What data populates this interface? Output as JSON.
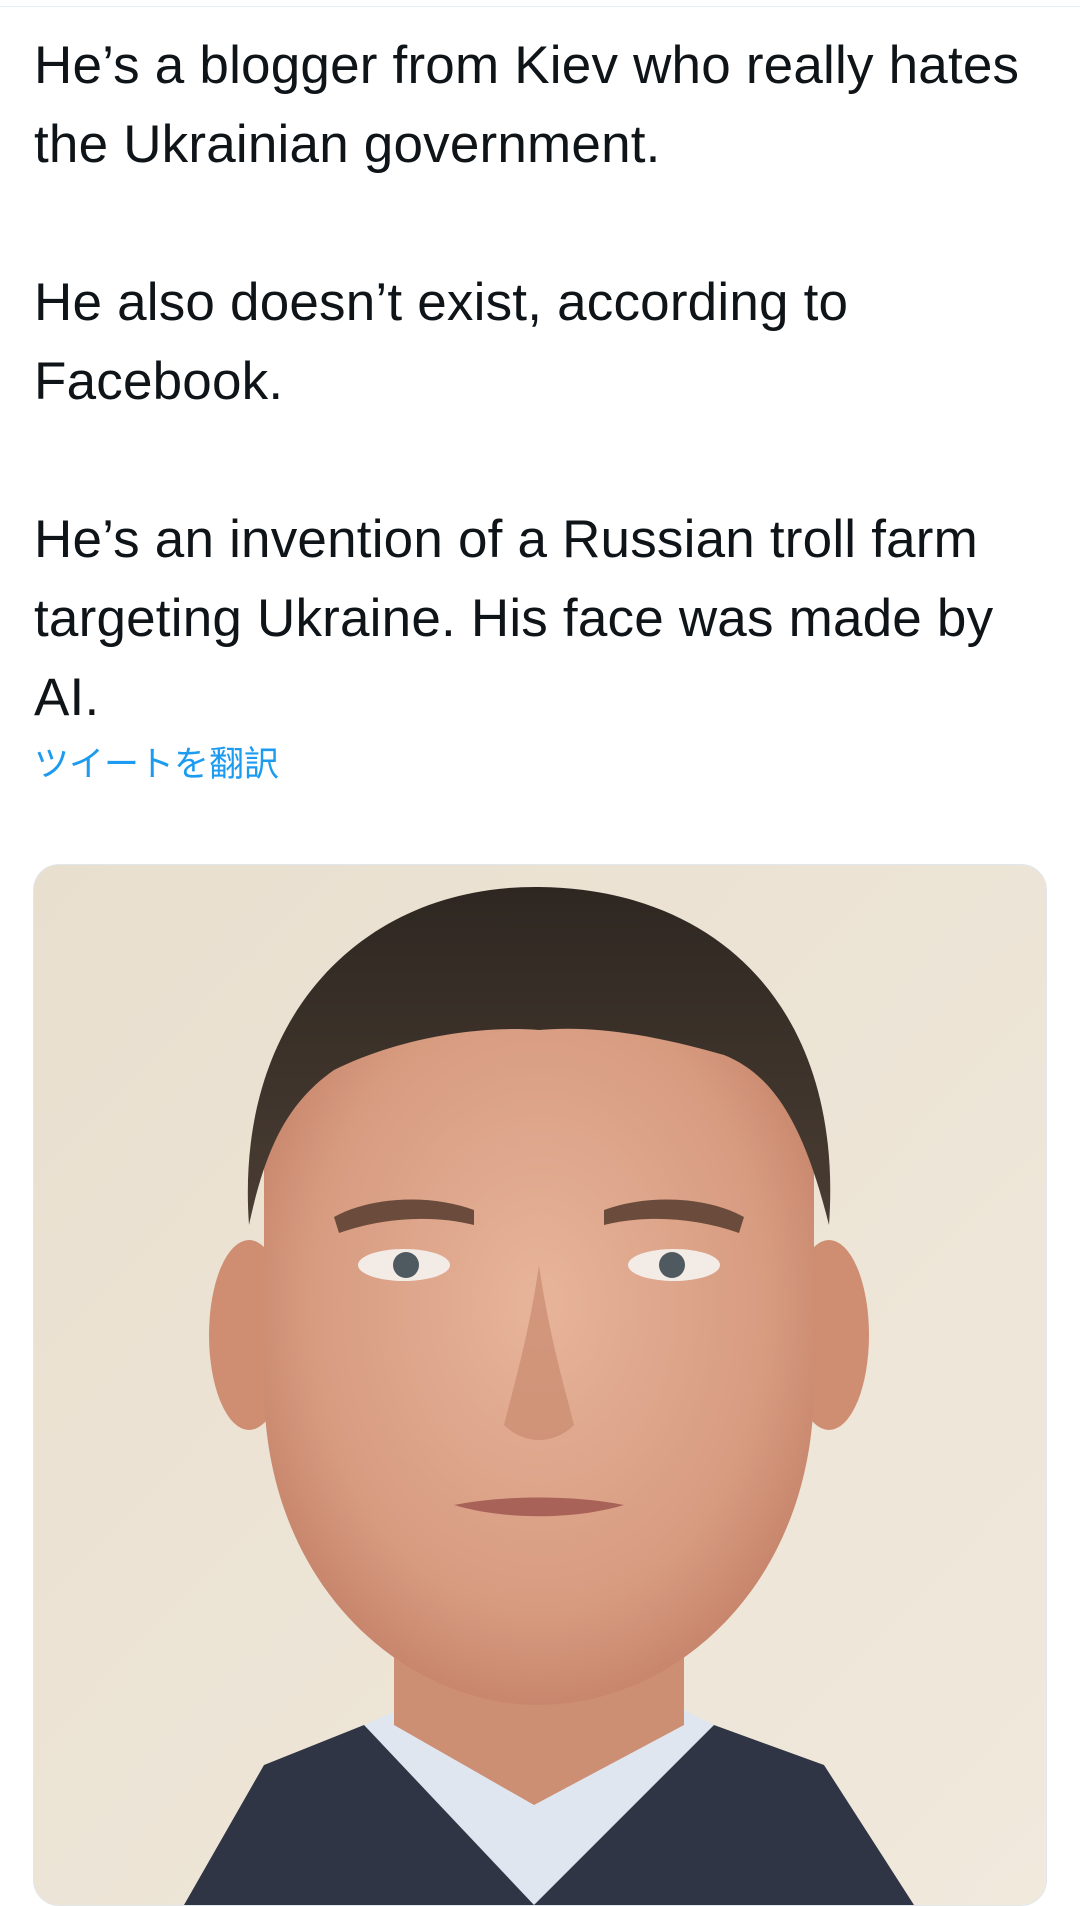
{
  "tweet": {
    "paragraphs": [
      "He’s a blogger from Kiev who really hates the Ukrainian government.",
      "He also doesn’t exist, according to Facebook.",
      "He’s an invention of a Russian troll farm targeting Ukraine. His face was made by AI."
    ],
    "translate_label": "ツイートを翻訳"
  },
  "media": {
    "icon": "portrait-photo",
    "background_color": "#eee5d6"
  },
  "colors": {
    "text": "#0f1419",
    "link": "#1d9bf0",
    "border": "#e1e8ed"
  }
}
